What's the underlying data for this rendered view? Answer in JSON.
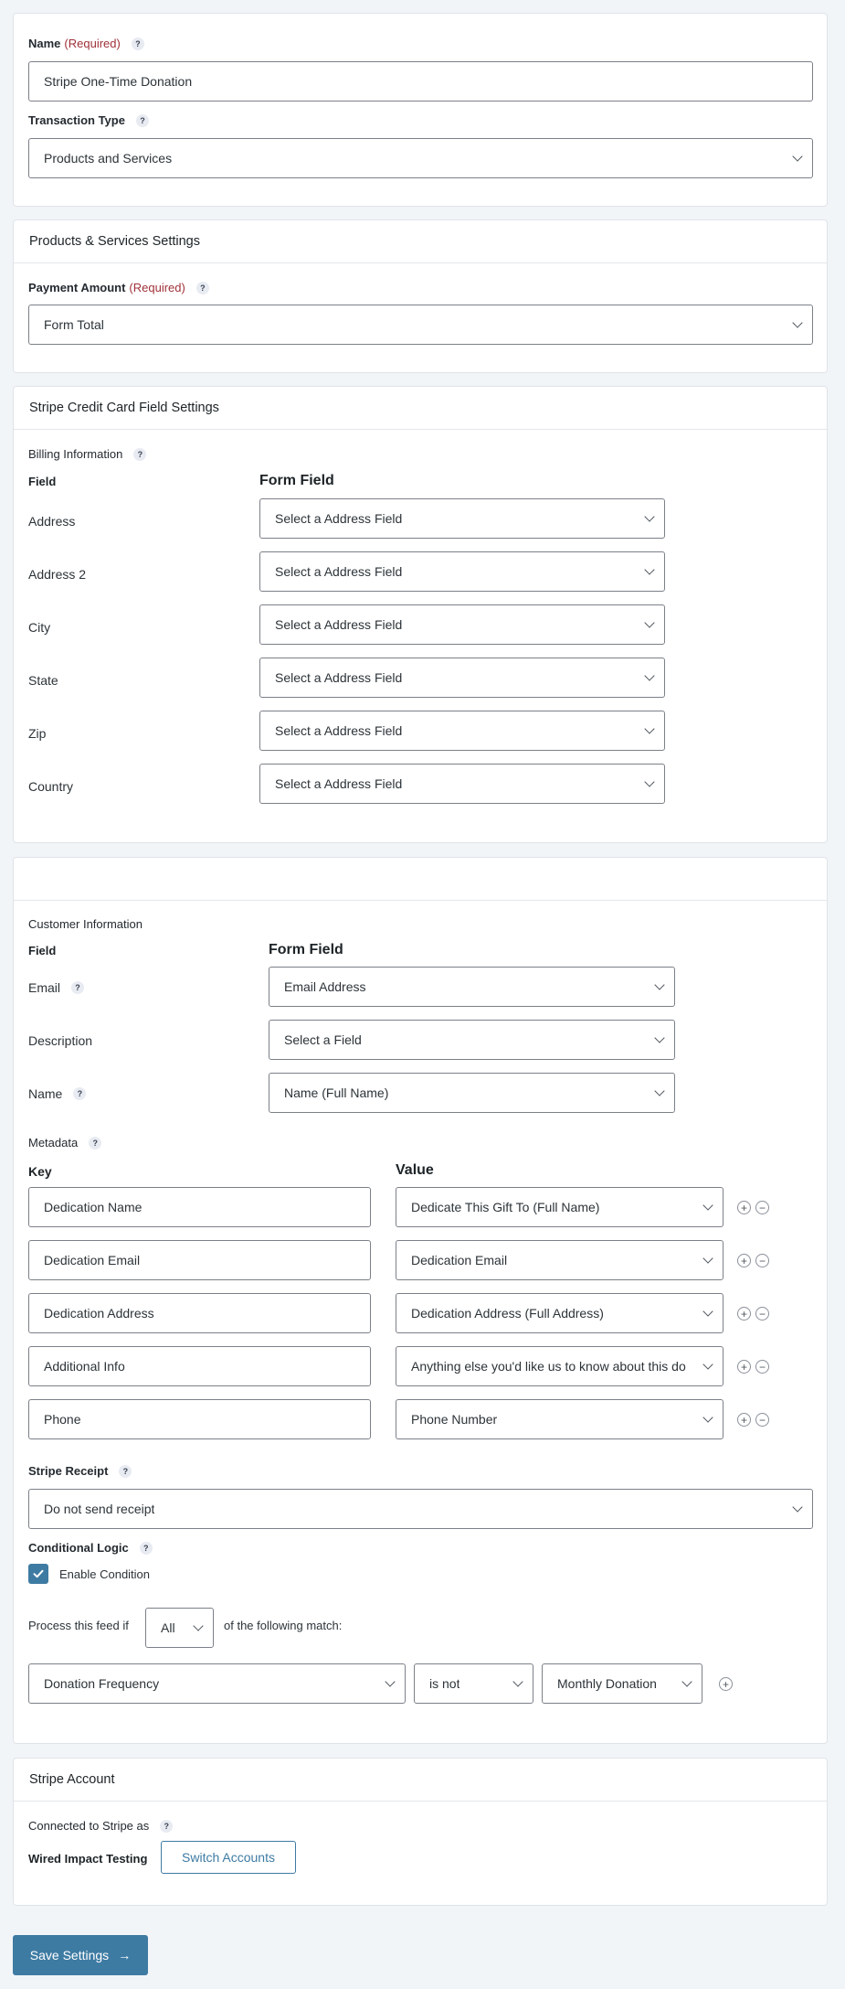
{
  "feed": {
    "name_label": "Name",
    "name_required": "(Required)",
    "name_value": "Stripe One-Time Donation",
    "transaction_type_label": "Transaction Type",
    "transaction_type_value": "Products and Services"
  },
  "products_services": {
    "title": "Products & Services Settings",
    "payment_amount_label": "Payment Amount",
    "payment_amount_required": "(Required)",
    "payment_amount_value": "Form Total"
  },
  "credit_card": {
    "title": "Stripe Credit Card Field Settings",
    "billing_label": "Billing Information",
    "col_field": "Field",
    "col_form_field": "Form Field",
    "rows": [
      {
        "label": "Address",
        "value": "Select a Address Field"
      },
      {
        "label": "Address 2",
        "value": "Select a Address Field"
      },
      {
        "label": "City",
        "value": "Select a Address Field"
      },
      {
        "label": "State",
        "value": "Select a Address Field"
      },
      {
        "label": "Zip",
        "value": "Select a Address Field"
      },
      {
        "label": "Country",
        "value": "Select a Address Field"
      }
    ]
  },
  "customer": {
    "label": "Customer Information",
    "col_field": "Field",
    "col_form_field": "Form Field",
    "rows": [
      {
        "label": "Email",
        "value": "Email Address"
      },
      {
        "label": "Description",
        "value": "Select a Field"
      },
      {
        "label": "Name",
        "value": "Name (Full Name)"
      }
    ]
  },
  "metadata": {
    "label": "Metadata",
    "col_key": "Key",
    "col_value": "Value",
    "rows": [
      {
        "key": "Dedication Name",
        "value": "Dedicate This Gift To (Full Name)"
      },
      {
        "key": "Dedication Email",
        "value": "Dedication Email"
      },
      {
        "key": "Dedication Address",
        "value": "Dedication Address (Full Address)"
      },
      {
        "key": "Additional Info",
        "value": "Anything else you'd like us to know about this do"
      },
      {
        "key": "Phone",
        "value": "Phone Number"
      }
    ],
    "add_symbol": "+",
    "remove_symbol": "−"
  },
  "receipt": {
    "label": "Stripe Receipt",
    "value": "Do not send receipt"
  },
  "conditional": {
    "label": "Conditional Logic",
    "enable_label": "Enable Condition",
    "process_prefix": "Process this feed if",
    "match_value": "All",
    "process_suffix": "of the following match:",
    "rule_field": "Donation Frequency",
    "rule_operator": "is not",
    "rule_value": "Monthly Donation",
    "add_symbol": "+"
  },
  "account": {
    "title": "Stripe Account",
    "connected_label": "Connected to Stripe as",
    "account_name": "Wired Impact Testing",
    "switch_label": "Switch Accounts"
  },
  "save": {
    "label": "Save Settings",
    "arrow": "→"
  },
  "colors": {
    "accent": "#3e7ba3",
    "required": "#a0313a",
    "border": "#7b8088"
  }
}
